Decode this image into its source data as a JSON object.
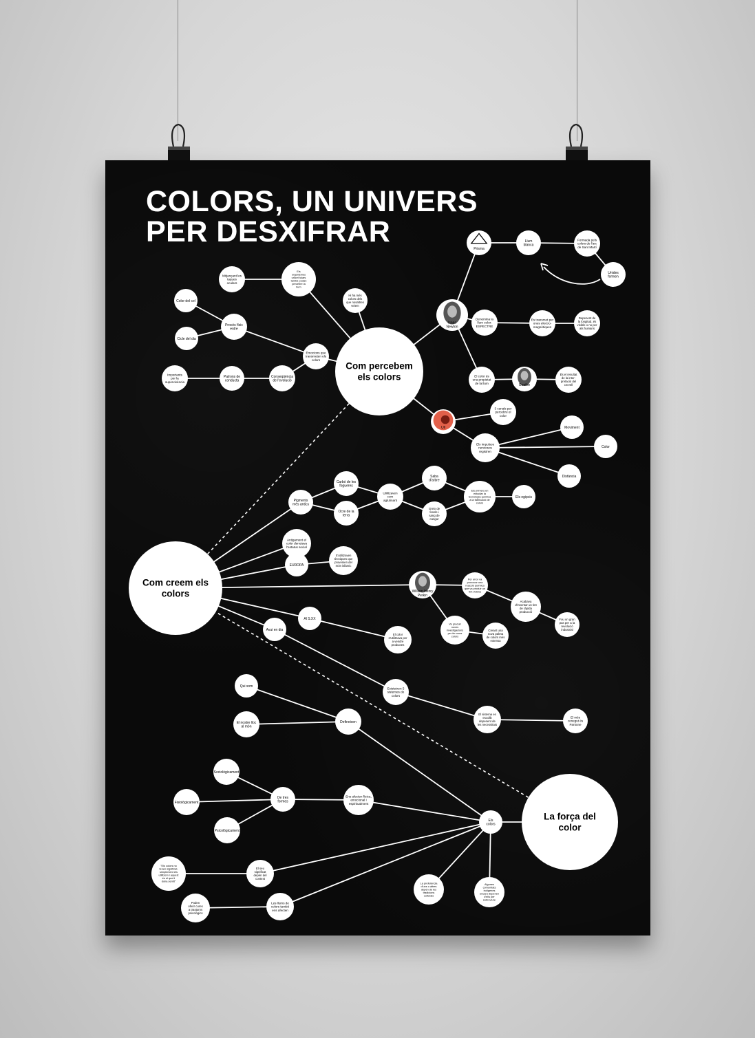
{
  "title": [
    "COLORS, UN UNIVERS",
    "PER DESXIFRAR"
  ],
  "colors": {
    "background": "#0a0a0a",
    "node": "#ffffff",
    "line": "#ffffff",
    "text": "#000000"
  },
  "nodes": [
    {
      "id": "hub1",
      "label": [
        "Com percebem",
        "els colors"
      ],
      "hub": true
    },
    {
      "id": "hub2",
      "label": [
        "Com creem els",
        "colors"
      ],
      "hub": true
    },
    {
      "id": "hub3",
      "label": [
        "La força del",
        "color"
      ],
      "hub": true
    },
    {
      "id": "prisma",
      "label": [
        "Prisma"
      ],
      "icon": "prism-triangle-icon"
    },
    {
      "id": "llum",
      "label": [
        "Llum",
        "blanca"
      ]
    },
    {
      "id": "formada",
      "label": [
        "Formada pels",
        "colors de l'arc",
        "de Sant Martí"
      ]
    },
    {
      "id": "unides",
      "label": [
        "Unides",
        "formen"
      ]
    },
    {
      "id": "newton",
      "label": [
        "Isaac",
        "Newton"
      ],
      "icon": "newton-portrait-icon"
    },
    {
      "id": "denomina",
      "label": [
        "Denomina la",
        "llum color:",
        "ESPECTRE"
      ]
    },
    {
      "id": "estransmet",
      "label": [
        "Es transmet per",
        "ones electro-",
        "magnètiques"
      ]
    },
    {
      "id": "depenent",
      "label": [
        "Depenent de",
        "la longitud, és",
        "visible o no per",
        "als humans"
      ]
    },
    {
      "id": "propietat",
      "label": [
        "El color és",
        "una propietat",
        "de la llum"
      ]
    },
    {
      "id": "goethe",
      "label": [
        "Goethe"
      ],
      "icon": "goethe-portrait-icon"
    },
    {
      "id": "resultat",
      "label": [
        "És el resultat",
        "de la inter-",
        "pretació del",
        "cervell"
      ]
    },
    {
      "id": "ull",
      "label": [
        "Ull"
      ],
      "icon": "eye-icon"
    },
    {
      "id": "canals",
      "label": [
        "3 canals per",
        "percebre el",
        "color"
      ]
    },
    {
      "id": "impulsos",
      "label": [
        "Els impulsos",
        "nerviosos",
        "registren"
      ]
    },
    {
      "id": "moviment",
      "label": [
        "Moviment"
      ]
    },
    {
      "id": "colornode",
      "label": [
        "Color"
      ]
    },
    {
      "id": "distancia",
      "label": [
        "Distància"
      ]
    },
    {
      "id": "hihamesa",
      "label": [
        "Hi ha més",
        "colors dels",
        "que nosaltres",
        "veiem"
      ]
    },
    {
      "id": "organismes",
      "label": [
        "Els",
        "organismes",
        "unicel·lulars",
        "també podan",
        "percebre la",
        "llum"
      ]
    },
    {
      "id": "mitjancant",
      "label": [
        "Mitjançant les",
        "taques",
        "oculars"
      ]
    },
    {
      "id": "colorcel",
      "label": [
        "Color del cel"
      ]
    },
    {
      "id": "proces",
      "label": [
        "Procés físic",
        "entre"
      ]
    },
    {
      "id": "cicle",
      "label": [
        "Cicle del dia"
      ]
    },
    {
      "id": "emocions",
      "label": [
        "Emocions que",
        "transmeten els",
        "colors"
      ]
    },
    {
      "id": "importants",
      "label": [
        "Importants",
        "per la",
        "supervivència"
      ]
    },
    {
      "id": "patrons",
      "label": [
        "Patrons de",
        "conducta"
      ]
    },
    {
      "id": "consequencia",
      "label": [
        "Conseqüència",
        "de l'evolució"
      ]
    },
    {
      "id": "pigments",
      "label": [
        "Pigments",
        "més antics"
      ]
    },
    {
      "id": "carbo",
      "label": [
        "Carbó de les",
        "fogueres"
      ]
    },
    {
      "id": "ocre",
      "label": [
        "Ocre de la",
        "terra"
      ]
    },
    {
      "id": "utilitzaven",
      "label": [
        "Utilitzaven",
        "com",
        "aglutinant"
      ]
    },
    {
      "id": "saba",
      "label": [
        "Saba",
        "d'arbre"
      ]
    },
    {
      "id": "greix",
      "label": [
        "Greix de",
        "fesols i",
        "sang de",
        "cangur"
      ]
    },
    {
      "id": "primers",
      "label": [
        "Els primers en",
        "estudiar la",
        "tecnologia química",
        "a la fabricació de",
        "colors"
      ]
    },
    {
      "id": "egipcis",
      "label": [
        "Els egipcis"
      ]
    },
    {
      "id": "antigament",
      "label": [
        "Antigament el",
        "color denotava",
        "l'estatus social"
      ]
    },
    {
      "id": "europa",
      "label": [
        "EUROPA"
      ]
    },
    {
      "id": "utilitzaven2",
      "label": [
        "S'utilitzaven",
        "tècniques que",
        "provenien del",
        "món islàmic"
      ]
    },
    {
      "id": "perkin",
      "label": [
        "William Henry",
        "Perkin"
      ],
      "icon": "perkin-portrait-icon"
    },
    {
      "id": "error",
      "label": [
        "Per error va",
        "provocar una",
        "reacció química",
        "que va produir un",
        "tint violeta"
      ]
    },
    {
      "id": "acabava",
      "label": [
        "Acabava",
        "d'inventar un tint",
        "de ràpida",
        "producció"
      ]
    },
    {
      "id": "fouungran",
      "label": [
        "Fou un gran",
        "pas per a la",
        "revolució",
        "industrial"
      ]
    },
    {
      "id": "vaproduir",
      "label": [
        "Va produir",
        "noves",
        "investigacions",
        "per fer nous",
        "colors"
      ]
    },
    {
      "id": "creantuna",
      "label": [
        "Creant una",
        "nova paleta",
        "de colors més",
        "extensa"
      ]
    },
    {
      "id": "alsxx",
      "label": [
        "Al S.XX"
      ]
    },
    {
      "id": "elcolor",
      "label": [
        "El color",
        "s'utilitzava per",
        "a vendre",
        "productes"
      ]
    },
    {
      "id": "avui",
      "label": [
        "Avui en dia"
      ]
    },
    {
      "id": "existeixen",
      "label": [
        "Existeixen 5",
        "sistemes de",
        "colors"
      ]
    },
    {
      "id": "sistema",
      "label": [
        "El sistema es",
        "escollit",
        "depenent de",
        "les necessitats"
      ]
    },
    {
      "id": "mesconegut",
      "label": [
        "El més",
        "conegut és",
        "Pantone"
      ]
    },
    {
      "id": "quisom",
      "label": [
        "Qui som"
      ]
    },
    {
      "id": "elnostre",
      "label": [
        "El nostre lloc",
        "al món"
      ]
    },
    {
      "id": "defineixen",
      "label": [
        "Defineixen"
      ]
    },
    {
      "id": "sociologicament",
      "label": [
        "Sociològicament"
      ]
    },
    {
      "id": "fisiologicament",
      "label": [
        "Fisiològicament"
      ]
    },
    {
      "id": "psicologicament",
      "label": [
        "Psicològicament"
      ]
    },
    {
      "id": "detres",
      "label": [
        "De tres",
        "formes"
      ]
    },
    {
      "id": "ensafecten",
      "label": [
        "Ens afecten física,",
        "emocional i",
        "espiritualment"
      ]
    },
    {
      "id": "elscolors",
      "label": [
        "Els",
        "colors"
      ]
    },
    {
      "id": "cita",
      "label": [
        "\"Els colors no",
        "tenen significat,",
        "simplement els",
        "utilitzem i aquest",
        "és el que li",
        "dóna sentit\""
      ]
    },
    {
      "id": "elseu",
      "label": [
        "El seu",
        "significat",
        "depèn del",
        "context"
      ]
    },
    {
      "id": "podenoferir",
      "label": [
        "Poden",
        "oferir cures",
        "a trastorns",
        "psicològics"
      ]
    },
    {
      "id": "lesllums",
      "label": [
        "Les llums de",
        "colors també",
        "ens afecten"
      ]
    },
    {
      "id": "preferencia",
      "label": [
        "La preferència",
        "d'uns o altres",
        "depèn de les",
        "tradicions",
        "culturals"
      ]
    },
    {
      "id": "algunes",
      "label": [
        "Algunes",
        "comunitats",
        "indígenes",
        "encara depenen",
        "d'ells per",
        "sobreviure"
      ]
    }
  ],
  "edges": [
    [
      "hub1",
      "newton"
    ],
    [
      "newton",
      "prisma"
    ],
    [
      "prisma",
      "llum"
    ],
    [
      "llum",
      "formada"
    ],
    [
      "formada",
      "unides"
    ],
    [
      "newton",
      "denomina"
    ],
    [
      "denomina",
      "estransmet"
    ],
    [
      "estransmet",
      "depenent"
    ],
    [
      "newton",
      "propietat"
    ],
    [
      "propietat",
      "goethe"
    ],
    [
      "goethe",
      "resultat"
    ],
    [
      "hub1",
      "ull"
    ],
    [
      "ull",
      "canals"
    ],
    [
      "ull",
      "impulsos"
    ],
    [
      "impulsos",
      "moviment"
    ],
    [
      "impulsos",
      "colornode"
    ],
    [
      "impulsos",
      "distancia"
    ],
    [
      "hub1",
      "hihamesa"
    ],
    [
      "hub1",
      "organismes"
    ],
    [
      "organismes",
      "mitjancant"
    ],
    [
      "hub1",
      "emocions"
    ],
    [
      "emocions",
      "proces"
    ],
    [
      "proces",
      "colorcel"
    ],
    [
      "proces",
      "cicle"
    ],
    [
      "emocions",
      "consequencia"
    ],
    [
      "consequencia",
      "patrons"
    ],
    [
      "patrons",
      "importants"
    ],
    [
      "hub2",
      "pigments"
    ],
    [
      "pigments",
      "carbo"
    ],
    [
      "pigments",
      "ocre"
    ],
    [
      "carbo",
      "utilitzaven"
    ],
    [
      "ocre",
      "utilitzaven"
    ],
    [
      "utilitzaven",
      "saba"
    ],
    [
      "utilitzaven",
      "greix"
    ],
    [
      "saba",
      "primers"
    ],
    [
      "greix",
      "primers"
    ],
    [
      "primers",
      "egipcis"
    ],
    [
      "hub2",
      "antigament"
    ],
    [
      "hub2",
      "europa"
    ],
    [
      "europa",
      "utilitzaven2"
    ],
    [
      "hub2",
      "perkin"
    ],
    [
      "perkin",
      "error"
    ],
    [
      "error",
      "acabava"
    ],
    [
      "acabava",
      "fouungran"
    ],
    [
      "perkin",
      "vaproduir"
    ],
    [
      "vaproduir",
      "creantuna"
    ],
    [
      "hub2",
      "alsxx"
    ],
    [
      "alsxx",
      "elcolor"
    ],
    [
      "hub2",
      "avui"
    ],
    [
      "avui",
      "existeixen"
    ],
    [
      "existeixen",
      "sistema"
    ],
    [
      "sistema",
      "mesconegut"
    ],
    [
      "quisom",
      "defineixen"
    ],
    [
      "elnostre",
      "defineixen"
    ],
    [
      "defineixen",
      "elscolors"
    ],
    [
      "sociologicament",
      "detres"
    ],
    [
      "fisiologicament",
      "detres"
    ],
    [
      "psicologicament",
      "detres"
    ],
    [
      "detres",
      "ensafecten"
    ],
    [
      "ensafecten",
      "elscolors"
    ],
    [
      "elscolors",
      "hub3"
    ],
    [
      "elscolors",
      "elseu"
    ],
    [
      "elseu",
      "cita"
    ],
    [
      "elscolors",
      "lesllums"
    ],
    [
      "lesllums",
      "podenoferir"
    ],
    [
      "elscolors",
      "preferencia"
    ],
    [
      "elscolors",
      "algunes"
    ]
  ],
  "dashed_edges": [
    [
      "hub1",
      "hub2"
    ],
    [
      "hub2",
      "hub3"
    ]
  ]
}
